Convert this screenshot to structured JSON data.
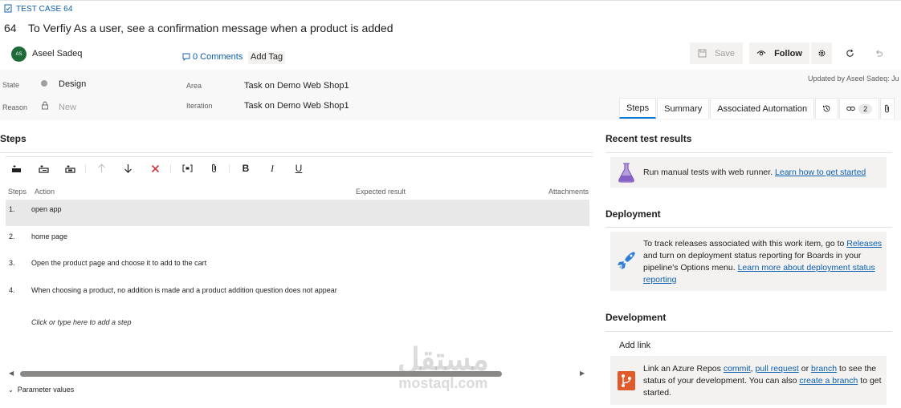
{
  "header": {
    "type_label": "TEST CASE 64",
    "id": "64",
    "title": "To Verfiy As a user,  see a confirmation message when a product is added",
    "assignee_initials": "AS",
    "assignee": "Aseel Sadeq",
    "comments": "0 Comments",
    "add_tag": "Add Tag",
    "save": "Save",
    "follow": "Follow",
    "updated": "Updated by Aseel Sadeq: Ju"
  },
  "fields": {
    "state_label": "State",
    "state_value": "Design",
    "state_color": "#a19f9d",
    "reason_label": "Reason",
    "reason_value": "New",
    "area_label": "Area",
    "area_value": "Task on Demo Web Shop1",
    "iteration_label": "Iteration",
    "iteration_value": "Task on Demo Web Shop1"
  },
  "tabs": [
    {
      "label": "Steps",
      "active": true
    },
    {
      "label": "Summary",
      "active": false
    },
    {
      "label": "Associated Automation",
      "active": false
    }
  ],
  "links_count": "2",
  "steps_section": {
    "title": "Steps",
    "columns": {
      "steps": "Steps",
      "action": "Action",
      "expected": "Expected result",
      "attachments": "Attachments"
    },
    "rows": [
      {
        "num": "1.",
        "action": "open app"
      },
      {
        "num": "2.",
        "action": "home page"
      },
      {
        "num": "3.",
        "action": "Open the product page and choose it to add to the cart"
      },
      {
        "num": "4.",
        "action": "When choosing a product, no addition is made and a product addition question does not appear"
      }
    ],
    "add_step_hint": "Click or type here to add a step",
    "parameter_values": "Parameter values"
  },
  "recent_results": {
    "title": "Recent test results",
    "text": "Run manual tests with web runner.",
    "link": "Learn how to get started"
  },
  "deployment": {
    "title": "Deployment",
    "text_1": "To track releases associated with this work item, go to",
    "link_releases": "Releases",
    "text_2": "and turn on deployment status reporting for Boards in your pipeline's Options menu.",
    "link_learn": "Learn more about deployment status reporting"
  },
  "development": {
    "title": "Development",
    "add_link": "Add link",
    "text_1": "Link an Azure Repos",
    "link_commit": "commit",
    "link_pr": "pull request",
    "text_or": "or",
    "link_branch": "branch",
    "text_2": "to see the status of your development. You can also",
    "link_create": "create a branch",
    "text_3": "to get started."
  },
  "watermark": {
    "arabic": "مستقل",
    "latin": "mostaql.com"
  },
  "colors": {
    "accent": "#0078d4",
    "link": "#0b5fad",
    "avatar": "#1e6b38",
    "delete": "#d13438"
  }
}
